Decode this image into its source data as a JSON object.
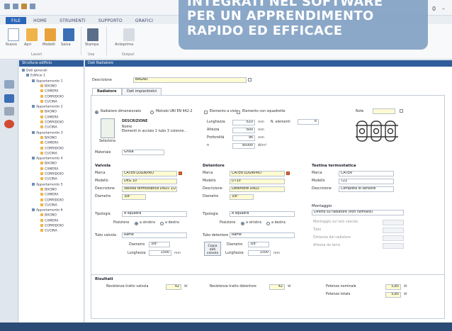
{
  "banner": {
    "line1": "INTEGRATI NEL SOFTWARE",
    "line2": "PER UN APPRENDIMENTO",
    "line3": "RAPIDO ED EFFICACE"
  },
  "window": {
    "counter": "0"
  },
  "menu": [
    "FILE",
    "HOME",
    "STRUMENTI",
    "SUPPORTO",
    "GRAFICI"
  ],
  "ribbon": {
    "buttons": [
      "Nuovo",
      "Apri",
      "Modelli",
      "Salva",
      "Stampa",
      "Anteprima"
    ],
    "groups": [
      "Lavori",
      "Usa",
      "Output"
    ]
  },
  "tree": {
    "title": "Struttura edificio",
    "root": "Dati generali",
    "level": "Edificio 1",
    "apartments": [
      {
        "name": "Appartamento 1",
        "rooms": [
          "BAGNO",
          "CAMERA",
          "CORRIDOIO",
          "CUCINA"
        ]
      },
      {
        "name": "Appartamento 2",
        "rooms": [
          "BAGNO",
          "CAMERA",
          "CORRIDOIO",
          "CUCINA"
        ]
      },
      {
        "name": "Appartamento 3",
        "rooms": [
          "BAGNO",
          "CAMERA",
          "CORRIDOIO",
          "CUCINA"
        ]
      },
      {
        "name": "Appartamento 4",
        "rooms": [
          "BAGNO",
          "CAMERA",
          "CORRIDOIO",
          "CUCINA"
        ]
      },
      {
        "name": "Appartamento 5",
        "rooms": [
          "BAGNO",
          "CAMERA",
          "CORRIDOIO",
          "CUCINA"
        ]
      },
      {
        "name": "Appartamento 6",
        "rooms": [
          "BAGNO",
          "CAMERA",
          "CORRIDOIO",
          "CUCINA"
        ]
      }
    ]
  },
  "form": {
    "header": "Dati Radiatore",
    "desc_label": "Descrizione",
    "desc_value": "BAGNO",
    "tabs": [
      "Radiatore",
      "Dati impiantistici"
    ],
    "modes": [
      "Radiatore dimensionato",
      "Metodo UNI EN 442-2",
      "Elemento a vista",
      "Elemento con squadrette"
    ],
    "item_name": "DESCRIZIONE",
    "item_sub": "Nome",
    "item_desc": "Elementi in acciaio 1 tubo 3 colonne...",
    "item_button": "Seleziona",
    "dims": [
      {
        "label": "Lunghezza",
        "value": "610",
        "unit": "mm"
      },
      {
        "label": "Altezza",
        "value": "600",
        "unit": "mm"
      },
      {
        "label": "Profondità",
        "value": "96",
        "unit": "mm"
      },
      {
        "label": "n",
        "value": "95000",
        "unit": "W/m³"
      }
    ],
    "n_elements_label": "N. elementi",
    "n_elements_value": "6",
    "note_label": "Note",
    "material_label": "Materiale",
    "material_value": "Ghisa",
    "valve": {
      "title": "Valvola",
      "rows": [
        {
          "label": "Marca",
          "value": "CATEN LOGIKPRO"
        },
        {
          "label": "Modello",
          "value": "DEG 10"
        },
        {
          "label": "Descrizione",
          "value": "Valvola termostatica DN15 1/2\""
        },
        {
          "label": "Diametro",
          "value": "3/8\""
        }
      ],
      "type_label": "Tipologia",
      "type_value": "A squadra",
      "position_label": "Posizione",
      "positions": [
        "a sinistra",
        "a destra"
      ],
      "tube_label": "Tubo valvola",
      "tube_value": "Rame",
      "diam_label": "Diametro",
      "diam_value": "3/8\"",
      "length_label": "Lunghezza",
      "length_value": "1500",
      "length_unit": "mm"
    },
    "detentor": {
      "title": "Detentore",
      "rows": [
        {
          "label": "Marca",
          "value": "CATEN LOGIKPRO"
        },
        {
          "label": "Modello",
          "value": "DT10"
        },
        {
          "label": "Descrizione",
          "value": "Detentore DN15"
        },
        {
          "label": "Diametro",
          "value": "3/8\""
        }
      ],
      "type_label": "Tipologia",
      "type_value": "A squadra",
      "position_label": "Posizione",
      "positions": [
        "a sinistra",
        "a destra"
      ],
      "tube_label": "Tubo detentore",
      "tube_value": "Rame",
      "diam_label": "Diametro",
      "diam_value": "3/8\"",
      "length_label": "Lunghezza",
      "length_value": "1500",
      "length_unit": "mm",
      "copy_button": "Copia dati valvola"
    },
    "thermo": {
      "title": "Testina termostatica",
      "rows": [
        {
          "label": "Marca",
          "value": "CATEN"
        },
        {
          "label": "Modello",
          "value": "T22"
        },
        {
          "label": "Descrizione",
          "value": "Completa di sensore"
        }
      ],
      "mount_title": "Montaggio",
      "mount_value": "Diretto su radiatore (non raffinato)",
      "extra_rows": [
        "Montaggio sul lato valvola",
        "Tubo",
        "Distanza dal radiatore",
        "Altezza da terra"
      ]
    },
    "results": {
      "title": "Risultati",
      "items": [
        {
          "label": "Resistenza tratto valvola",
          "value": "42",
          "unit": "W"
        },
        {
          "label": "Resistenza tratto detentore",
          "value": "42",
          "unit": "W"
        },
        {
          "label": "Potenza nominale",
          "value": "5,85",
          "unit": "W"
        },
        {
          "label": "Potenza totale",
          "value": "5,85",
          "unit": "W"
        }
      ]
    }
  },
  "colors": {
    "accent": "#2b65b6",
    "banner": "#86a4c6",
    "field_highlight": "#fffbd2"
  }
}
